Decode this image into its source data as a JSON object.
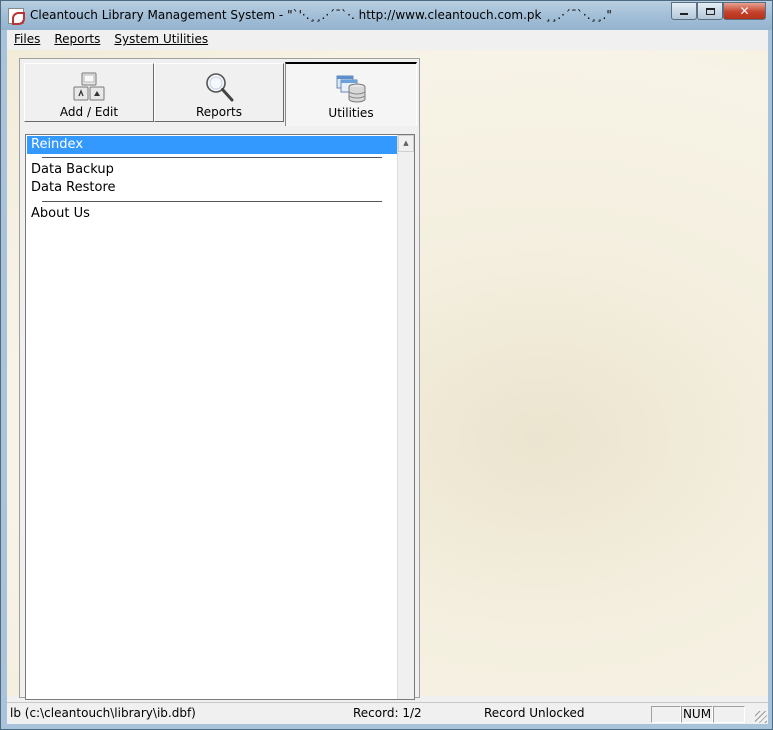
{
  "window": {
    "title": "Cleantouch Library Management System  -  \"`'·.¸¸.·´¯`·. http://www.cleantouch.com.pk ¸¸.·´¯`·.¸¸.\""
  },
  "menu": [
    {
      "label": "Files"
    },
    {
      "label": "Reports"
    },
    {
      "label": "System Utilities"
    }
  ],
  "tabs": [
    {
      "label": "Add / Edit",
      "icon": "keyboard-keys-icon"
    },
    {
      "label": "Reports",
      "icon": "magnifier-icon"
    },
    {
      "label": "Utilities",
      "icon": "database-utilities-icon",
      "active": true
    }
  ],
  "utilities_list": {
    "items": [
      "Reindex",
      "Data Backup",
      "Data Restore",
      "About Us"
    ],
    "selected": "Reindex"
  },
  "statusbar": {
    "file": "lb (c:\\cleantouch\\library\\ib.dbf)",
    "record": "Record: 1/2",
    "lock": "Record Unlocked",
    "num": "NUM"
  },
  "colors": {
    "selection": "#3399ff",
    "workspace": "#f4efdf",
    "close_button": "#c5432c"
  }
}
